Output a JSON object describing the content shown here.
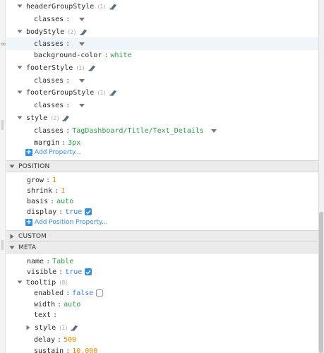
{
  "props": {
    "header_group_style": {
      "key": "headerGroupStyle",
      "count": "(1)"
    },
    "header_group_classes": {
      "key": "classes",
      "value": ""
    },
    "body_style": {
      "key": "bodyStyle",
      "count": "(2)"
    },
    "body_classes": {
      "key": "classes",
      "value": ""
    },
    "body_bg": {
      "key": "background-color",
      "value": "white"
    },
    "footer_style": {
      "key": "footerStyle",
      "count": "(1)"
    },
    "footer_classes": {
      "key": "classes",
      "value": ""
    },
    "footer_group_style": {
      "key": "footerGroupStyle",
      "count": "(1)"
    },
    "footer_group_classes": {
      "key": "classes",
      "value": ""
    },
    "style": {
      "key": "style",
      "count": "(2)"
    },
    "style_classes": {
      "key": "classes",
      "value": "TagDashboard/Title/Text_Details"
    },
    "style_margin": {
      "key": "margin",
      "value": "3px"
    },
    "add_property": "Add Property..."
  },
  "position": {
    "title": "POSITION",
    "grow": {
      "key": "grow",
      "value": "1"
    },
    "shrink": {
      "key": "shrink",
      "value": "1"
    },
    "basis": {
      "key": "basis",
      "value": "auto"
    },
    "display": {
      "key": "display",
      "value": "true",
      "checked": true
    },
    "add_property": "Add Position Property..."
  },
  "custom": {
    "title": "CUSTOM"
  },
  "meta": {
    "title": "META",
    "name": {
      "key": "name",
      "value": "Table"
    },
    "visible": {
      "key": "visible",
      "value": "true",
      "checked": true
    },
    "tooltip": {
      "key": "tooltip",
      "count": "(8)"
    },
    "enabled": {
      "key": "enabled",
      "value": "false",
      "checked": false
    },
    "width": {
      "key": "width",
      "value": "auto"
    },
    "text": {
      "key": "text",
      "value": ""
    },
    "style": {
      "key": "style",
      "count": "(1)"
    },
    "delay": {
      "key": "delay",
      "value": "500"
    },
    "sustain": {
      "key": "sustain",
      "value": "10,000"
    }
  },
  "colors": {
    "string": "#2e9a47",
    "number": "#e08a00",
    "boolean": "#3a7ed1",
    "accent": "#3a8fd9",
    "section_bg": "#ebebeb"
  }
}
